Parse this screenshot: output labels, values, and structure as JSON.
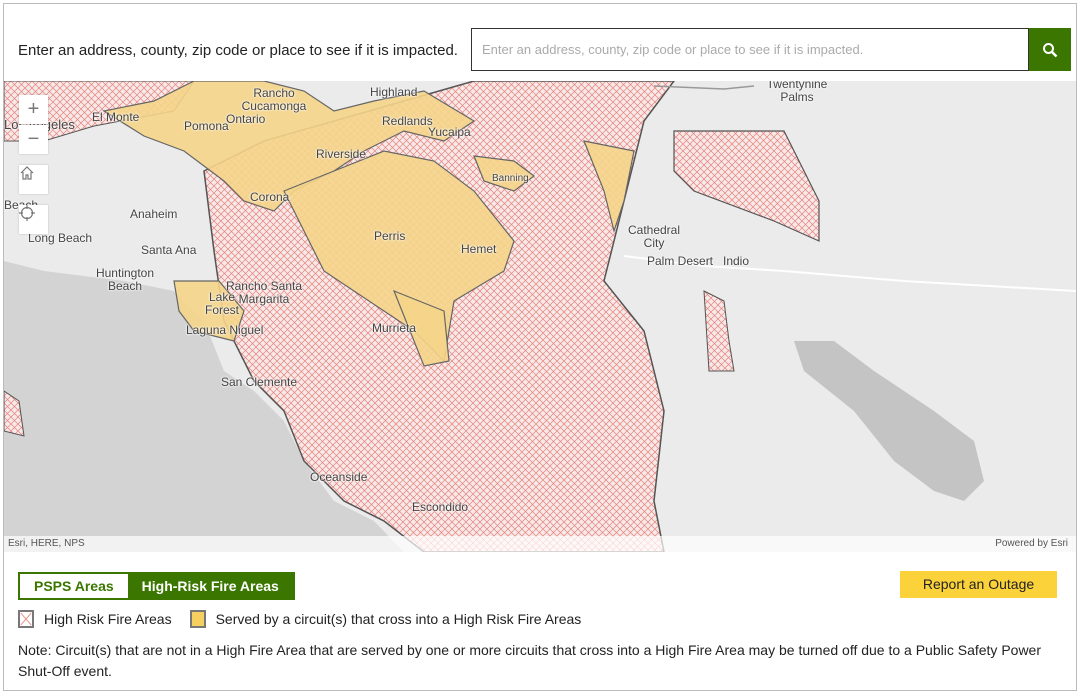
{
  "header": {
    "prompt": "Enter an address, county, zip code or place to see if it is impacted.",
    "search_placeholder": "Enter an address, county, zip code or place to see if it is impacted.",
    "search_value": "",
    "search_icon": "search-icon"
  },
  "map": {
    "controls": [
      "zoom-in",
      "zoom-out",
      "home",
      "locate"
    ],
    "colors": {
      "land": "#ebebeb",
      "ocean": "#d3d3d3",
      "high_risk_hatch": "#e8827a",
      "served": "#f5d58a",
      "boundary": "#555555",
      "lake": "#c4c4c4"
    },
    "labels": [
      "Twentynine Palms",
      "Rancho Cucamonga",
      "Highland",
      "Los Angeles",
      "El Monte",
      "Pomona",
      "Ontario",
      "Redlands",
      "Yucaipa",
      "Riverside",
      "Banning",
      "Corona",
      "Anaheim",
      "Beach",
      "Long Beach",
      "Perris",
      "Hemet",
      "Cathedral City",
      "Santa Ana",
      "Palm Desert",
      "Indio",
      "Huntington Beach",
      "Rancho Santa Margarita",
      "Lake Forest",
      "Laguna Niguel",
      "Murrieta",
      "San Clemente",
      "Oceanside",
      "Escondido"
    ],
    "attribution_left": "Esri, HERE, NPS",
    "attribution_right": "Powered by Esri"
  },
  "tabs": [
    {
      "label": "PSPS Areas",
      "active": false
    },
    {
      "label": "High-Risk Fire Areas",
      "active": true
    }
  ],
  "report_button": "Report an Outage",
  "legend": [
    {
      "label": "High Risk Fire Areas",
      "color": "#e8827a"
    },
    {
      "label": "Served by a circuit(s) that cross into a High Risk Fire Areas",
      "color": "#f5d060"
    }
  ],
  "note": "Note: Circuit(s) that are not in a High Fire Area that are served by one or more circuits that cross into a High Fire Area may be turned off due to a Public Safety Power Shut-Off event."
}
